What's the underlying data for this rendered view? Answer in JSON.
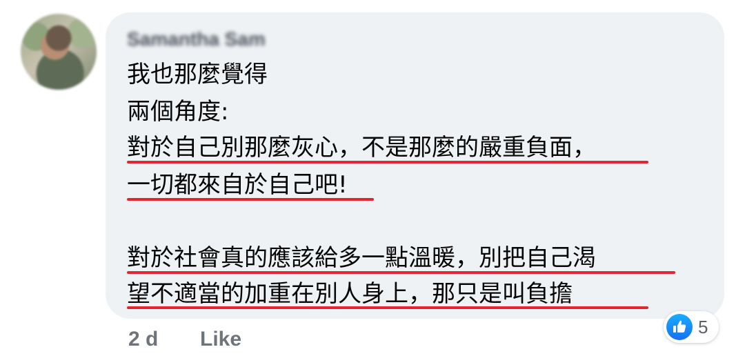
{
  "comment": {
    "author": "Samantha Sam",
    "lines": [
      "我也那麼覺得",
      "兩個角度:",
      "對於自己別那麼灰心，不是那麼的嚴重負面，",
      "一切都來自於自己吧!",
      "",
      "對於社會真的應該給多一點溫暖，別把自己渴",
      "望不適當的加重在別人身上，那只是叫負擔"
    ],
    "timestamp": "2 d",
    "like_label": "Like",
    "reaction_count": "5"
  },
  "colors": {
    "bubble": "#eff2f5",
    "underline": "#e3262e",
    "like_blue": "#1877f2",
    "meta_text": "#6f747c"
  },
  "icons": {
    "reaction": "thumbs-up-icon"
  }
}
